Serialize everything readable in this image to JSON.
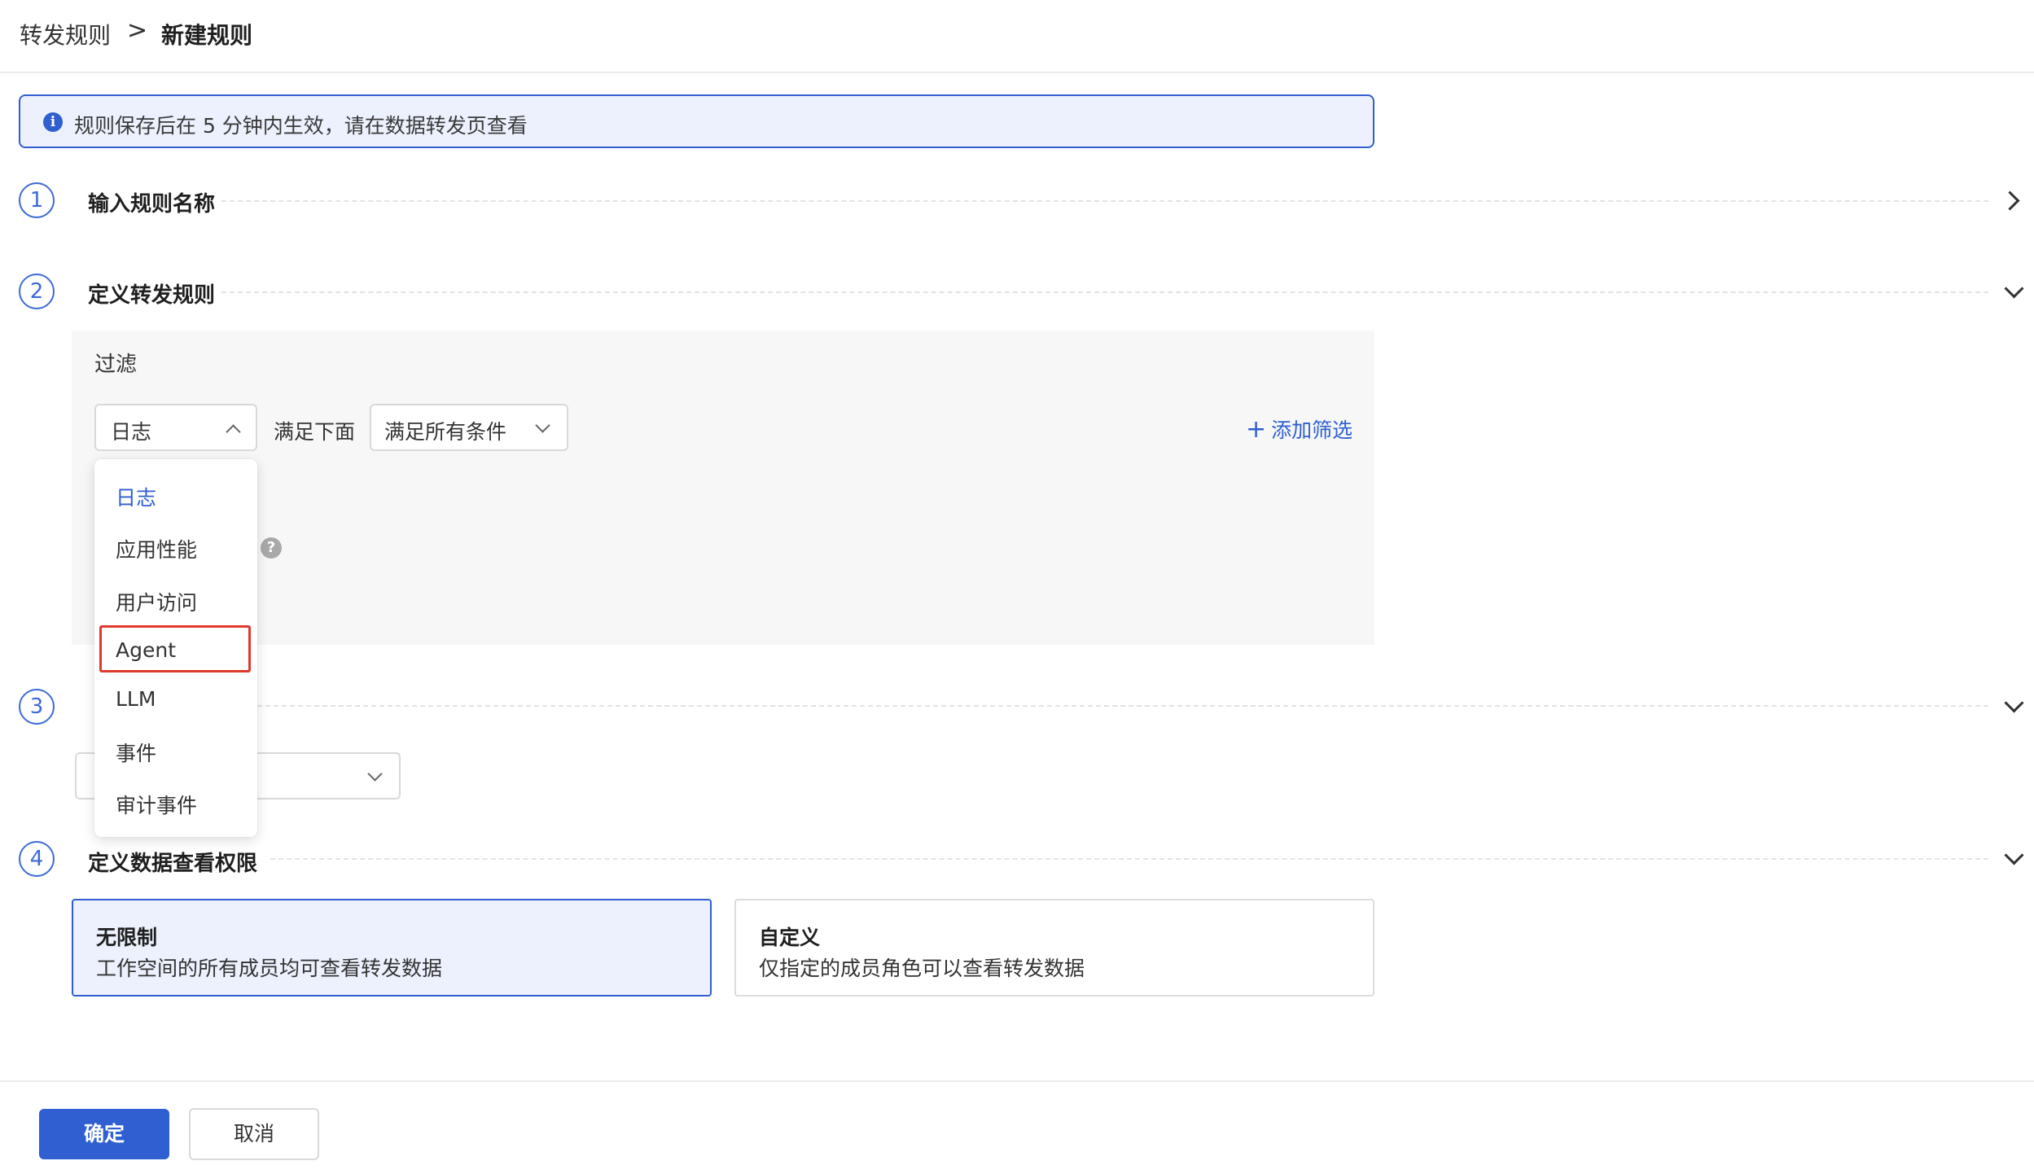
{
  "breadcrumb": {
    "root": "转发规则",
    "separator": ">",
    "current": "新建规则"
  },
  "notice": {
    "icon": "info-icon",
    "icon_glyph": "i",
    "text": "规则保存后在 5 分钟内生效，请在数据转发页查看"
  },
  "steps": [
    {
      "number": "1",
      "title": "输入规则名称",
      "state": "collapsed"
    },
    {
      "number": "2",
      "title": "定义转发规则",
      "state": "expanded"
    },
    {
      "number": "3",
      "title": "",
      "state": "expanded"
    },
    {
      "number": "4",
      "title": "定义数据查看权限",
      "state": "expanded"
    }
  ],
  "filter": {
    "label": "过滤",
    "source_select": {
      "value": "日志",
      "open": true
    },
    "match_label": "满足下面",
    "match_select": {
      "value": "满足所有条件"
    },
    "add_filter": "添加筛选",
    "add_icon": "+",
    "help_glyph": "?"
  },
  "dropdown": {
    "options": [
      "日志",
      "应用性能",
      "用户访问",
      "Agent",
      "LLM",
      "事件",
      "审计事件"
    ],
    "selected": "日志",
    "highlighted": "Agent"
  },
  "permissions": [
    {
      "title": "无限制",
      "description": "工作空间的所有成员均可查看转发数据",
      "selected": true
    },
    {
      "title": "自定义",
      "description": "仅指定的成员角色可以查看转发数据",
      "selected": false
    }
  ],
  "footer": {
    "confirm": "确定",
    "cancel": "取消"
  },
  "colors": {
    "primary": "#2f5fd0",
    "highlight_border": "#e0392b",
    "notice_bg": "#ecf1fd"
  }
}
